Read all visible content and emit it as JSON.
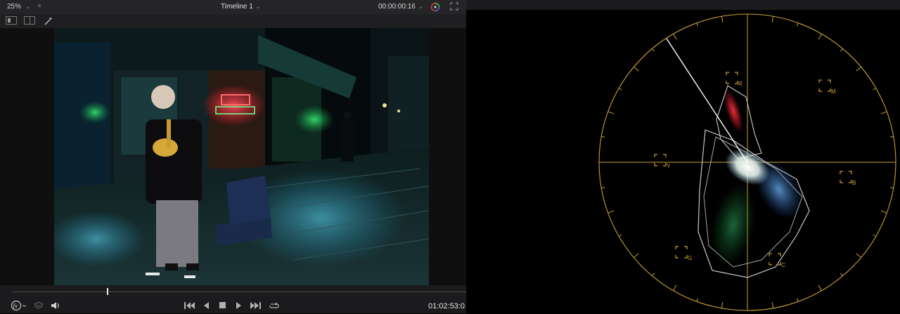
{
  "viewer": {
    "zoom": "25%",
    "timeline_title": "Timeline 1",
    "timecode_top": "00:00:00:16",
    "timecode_bottom": "01:02:53:0",
    "playhead_progress": 0.21
  },
  "icons": {
    "zoom_dropdown": "chevron-down-icon",
    "timeline_dropdown": "chevron-down-icon",
    "timecode_dropdown": "chevron-down-icon",
    "scope": "color-scope-icon",
    "fullscreen": "fullscreen-icon",
    "single_viewer": "single-viewer-icon",
    "split_viewer": "split-viewer-icon",
    "magic": "magic-wand-icon",
    "fx": "fx-icon",
    "layers": "layers-icon",
    "audio": "speaker-icon",
    "first_frame": "skip-to-start-icon",
    "reverse": "play-reverse-icon",
    "stop": "stop-icon",
    "play": "play-icon",
    "last_frame": "skip-to-end-icon",
    "loop": "loop-icon"
  },
  "scope": {
    "type": "vectorscope",
    "targets": [
      "R",
      "M",
      "Y",
      "B",
      "G",
      "C"
    ],
    "colors": {
      "graticule": "#c9a032",
      "skin_line": "#ffffff"
    }
  }
}
